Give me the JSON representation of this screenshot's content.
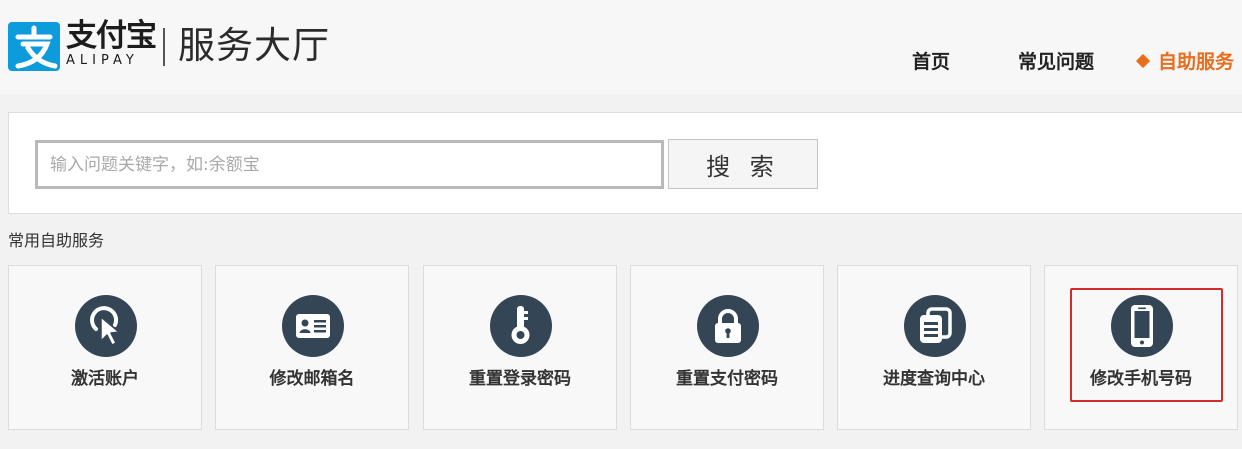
{
  "header": {
    "logo_icon": "alipay-logo-icon",
    "brand_cn": "支付宝",
    "brand_en": "ALIPAY",
    "hall_title": "服务大厅",
    "nav": {
      "home": "首页",
      "faq": "常见问题",
      "self_service": "自助服务"
    }
  },
  "search": {
    "placeholder": "输入问题关键字，如:余额宝",
    "button_label": "搜 索"
  },
  "common_services": {
    "title": "常用自助服务",
    "tiles": [
      {
        "label": "激活账户",
        "icon": "cursor-click-icon"
      },
      {
        "label": "修改邮箱名",
        "icon": "id-card-icon"
      },
      {
        "label": "重置登录密码",
        "icon": "key-icon"
      },
      {
        "label": "重置支付密码",
        "icon": "lock-icon"
      },
      {
        "label": "进度查询中心",
        "icon": "stacked-documents-icon"
      },
      {
        "label": "修改手机号码",
        "icon": "mobile-phone-icon"
      }
    ],
    "highlighted_index": 5
  },
  "colors": {
    "accent": "#e86e1e",
    "brand_blue": "#0e9bdb",
    "icon_bg": "#344656",
    "highlight_border": "#d22b2b"
  }
}
